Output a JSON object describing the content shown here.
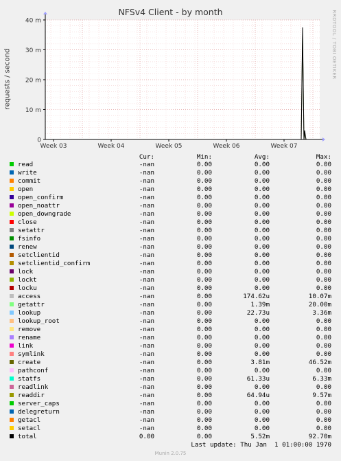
{
  "chart_data": {
    "type": "line",
    "title": "NFSv4 Client - by month",
    "ylabel": "requests / second",
    "yticks": [
      "0",
      "10 m",
      "20 m",
      "30 m",
      "40 m"
    ],
    "ylim": [
      0,
      40
    ],
    "xticks": [
      "Week 03",
      "Week 04",
      "Week 05",
      "Week 06",
      "Week 07"
    ],
    "grid": true,
    "series": [
      {
        "name": "total",
        "x": [
          "Week 07 start",
          "Week 07 early"
        ],
        "values_m": [
          0,
          37.5,
          0,
          3,
          0
        ],
        "color": "#000000"
      },
      {
        "name": "create",
        "values_m": [
          0,
          35,
          0,
          2,
          0
        ],
        "color": "#4F6228"
      }
    ]
  },
  "watermark": "RRDTOOL / TOBI OETIKER",
  "legend": {
    "headers": {
      "cur": "Cur:",
      "min": "Min:",
      "avg": "Avg:",
      "max": "Max:"
    },
    "rows": [
      {
        "name": "read",
        "color": "#00CC00",
        "cur": "-nan",
        "min": "0.00",
        "avg": "0.00",
        "max": "0.00"
      },
      {
        "name": "write",
        "color": "#0066B3",
        "cur": "-nan",
        "min": "0.00",
        "avg": "0.00",
        "max": "0.00"
      },
      {
        "name": "commit",
        "color": "#FF8000",
        "cur": "-nan",
        "min": "0.00",
        "avg": "0.00",
        "max": "0.00"
      },
      {
        "name": "open",
        "color": "#FFCC00",
        "cur": "-nan",
        "min": "0.00",
        "avg": "0.00",
        "max": "0.00"
      },
      {
        "name": "open_confirm",
        "color": "#330099",
        "cur": "-nan",
        "min": "0.00",
        "avg": "0.00",
        "max": "0.00"
      },
      {
        "name": "open_noattr",
        "color": "#990099",
        "cur": "-nan",
        "min": "0.00",
        "avg": "0.00",
        "max": "0.00"
      },
      {
        "name": "open_downgrade",
        "color": "#CCFF00",
        "cur": "-nan",
        "min": "0.00",
        "avg": "0.00",
        "max": "0.00"
      },
      {
        "name": "close",
        "color": "#FF0000",
        "cur": "-nan",
        "min": "0.00",
        "avg": "0.00",
        "max": "0.00"
      },
      {
        "name": "setattr",
        "color": "#808080",
        "cur": "-nan",
        "min": "0.00",
        "avg": "0.00",
        "max": "0.00"
      },
      {
        "name": "fsinfo",
        "color": "#008F00",
        "cur": "-nan",
        "min": "0.00",
        "avg": "0.00",
        "max": "0.00"
      },
      {
        "name": "renew",
        "color": "#00487D",
        "cur": "-nan",
        "min": "0.00",
        "avg": "0.00",
        "max": "0.00"
      },
      {
        "name": "setclientid",
        "color": "#B35A00",
        "cur": "-nan",
        "min": "0.00",
        "avg": "0.00",
        "max": "0.00"
      },
      {
        "name": "setclientid_confirm",
        "color": "#B38F00",
        "cur": "-nan",
        "min": "0.00",
        "avg": "0.00",
        "max": "0.00"
      },
      {
        "name": "lock",
        "color": "#6B006B",
        "cur": "-nan",
        "min": "0.00",
        "avg": "0.00",
        "max": "0.00"
      },
      {
        "name": "lockt",
        "color": "#8FB300",
        "cur": "-nan",
        "min": "0.00",
        "avg": "0.00",
        "max": "0.00"
      },
      {
        "name": "locku",
        "color": "#B30000",
        "cur": "-nan",
        "min": "0.00",
        "avg": "0.00",
        "max": "0.00"
      },
      {
        "name": "access",
        "color": "#BEBEBE",
        "cur": "-nan",
        "min": "0.00",
        "avg": "174.62u",
        "max": "10.07m"
      },
      {
        "name": "getattr",
        "color": "#80FF80",
        "cur": "-nan",
        "min": "0.00",
        "avg": "1.39m",
        "max": "20.00m"
      },
      {
        "name": "lookup",
        "color": "#80C9FF",
        "cur": "-nan",
        "min": "0.00",
        "avg": "22.73u",
        "max": "3.36m"
      },
      {
        "name": "lookup_root",
        "color": "#FFC080",
        "cur": "-nan",
        "min": "0.00",
        "avg": "0.00",
        "max": "0.00"
      },
      {
        "name": "remove",
        "color": "#FFE680",
        "cur": "-nan",
        "min": "0.00",
        "avg": "0.00",
        "max": "0.00"
      },
      {
        "name": "rename",
        "color": "#AA80FF",
        "cur": "-nan",
        "min": "0.00",
        "avg": "0.00",
        "max": "0.00"
      },
      {
        "name": "link",
        "color": "#EE00CC",
        "cur": "-nan",
        "min": "0.00",
        "avg": "0.00",
        "max": "0.00"
      },
      {
        "name": "symlink",
        "color": "#FF8080",
        "cur": "-nan",
        "min": "0.00",
        "avg": "0.00",
        "max": "0.00"
      },
      {
        "name": "create",
        "color": "#666600",
        "cur": "-nan",
        "min": "0.00",
        "avg": "3.81m",
        "max": "46.52m"
      },
      {
        "name": "pathconf",
        "color": "#FFBFFF",
        "cur": "-nan",
        "min": "0.00",
        "avg": "0.00",
        "max": "0.00"
      },
      {
        "name": "statfs",
        "color": "#00FFCC",
        "cur": "-nan",
        "min": "0.00",
        "avg": "61.33u",
        "max": "6.33m"
      },
      {
        "name": "readlink",
        "color": "#CC6699",
        "cur": "-nan",
        "min": "0.00",
        "avg": "0.00",
        "max": "0.00"
      },
      {
        "name": "readdir",
        "color": "#999900",
        "cur": "-nan",
        "min": "0.00",
        "avg": "64.94u",
        "max": "9.57m"
      },
      {
        "name": "server_caps",
        "color": "#00CC00",
        "cur": "-nan",
        "min": "0.00",
        "avg": "0.00",
        "max": "0.00"
      },
      {
        "name": "delegreturn",
        "color": "#0066B3",
        "cur": "-nan",
        "min": "0.00",
        "avg": "0.00",
        "max": "0.00"
      },
      {
        "name": "getacl",
        "color": "#FF8000",
        "cur": "-nan",
        "min": "0.00",
        "avg": "0.00",
        "max": "0.00"
      },
      {
        "name": "setacl",
        "color": "#FFCC00",
        "cur": "-nan",
        "min": "0.00",
        "avg": "0.00",
        "max": "0.00"
      },
      {
        "name": "total",
        "color": "#000000",
        "cur": "0.00",
        "min": "0.00",
        "avg": "5.52m",
        "max": "92.70m"
      }
    ]
  },
  "last_update": "Last update: Thu Jan  1 01:00:00 1970",
  "footer": "Munin 2.0.75"
}
